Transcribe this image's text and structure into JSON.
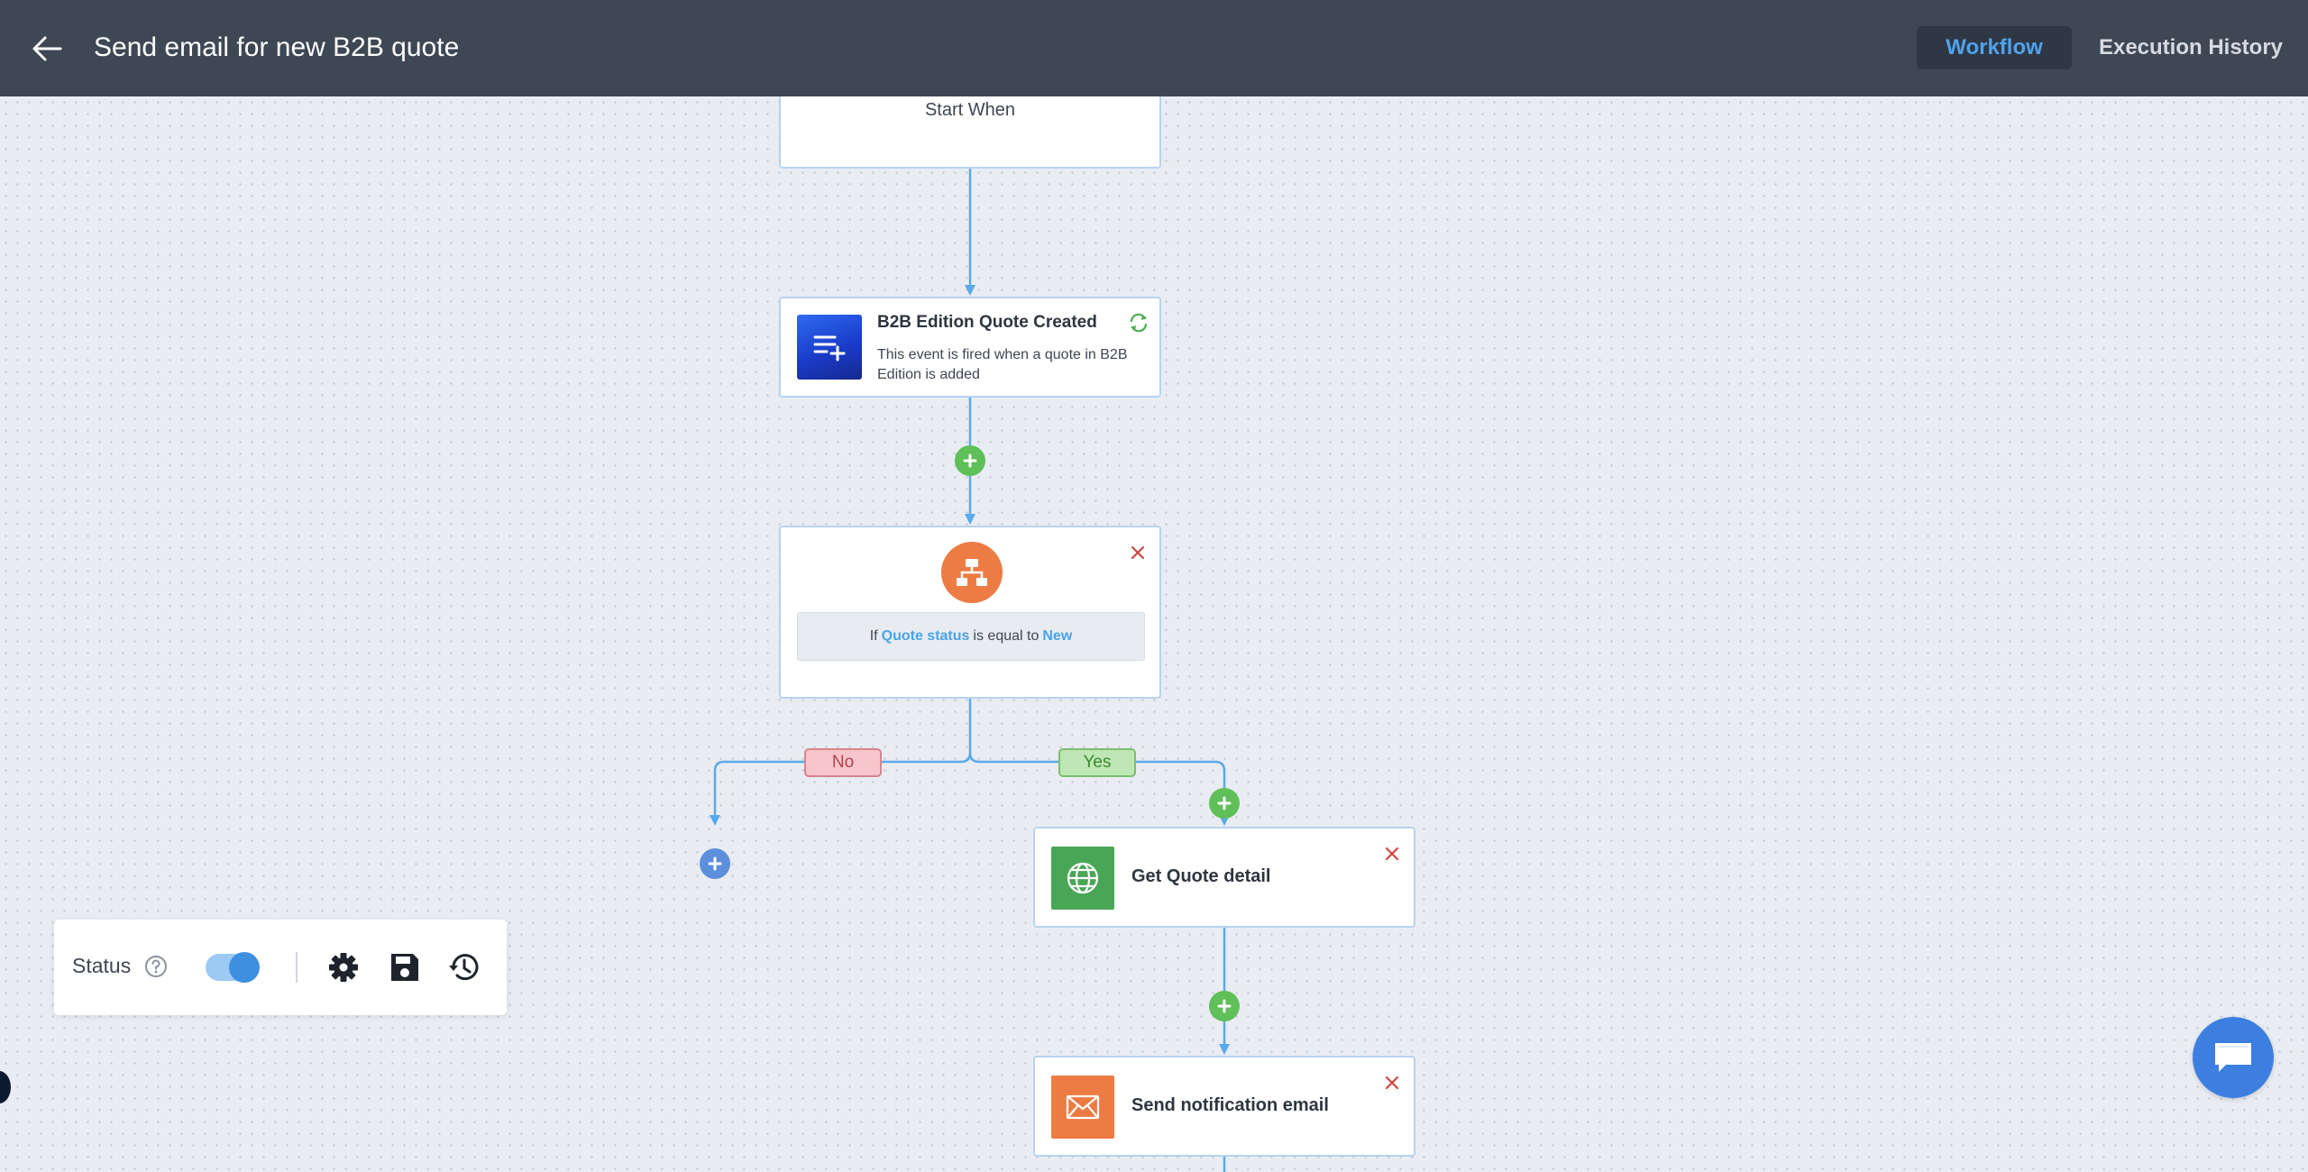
{
  "header": {
    "title": "Send email for new B2B quote",
    "tabs": [
      {
        "label": "Workflow",
        "active": true
      },
      {
        "label": "Execution History",
        "active": false
      }
    ]
  },
  "workflow": {
    "start": {
      "label": "Start When"
    },
    "trigger": {
      "title": "B2B Edition Quote Created",
      "description": "This event is fired when a quote in B2B Edition is added",
      "icon": "list-add-icon"
    },
    "condition": {
      "prefix": "If",
      "field": "Quote status",
      "operator": "is equal to",
      "value": "New",
      "icon": "sitemap-icon"
    },
    "branches": {
      "no_label": "No",
      "yes_label": "Yes"
    },
    "actions": [
      {
        "label": "Get Quote detail",
        "icon": "globe-icon",
        "color": "#4aa657"
      },
      {
        "label": "Send notification email",
        "icon": "envelope-icon",
        "color": "#ec7c44"
      }
    ]
  },
  "statusbar": {
    "status_label": "Status",
    "enabled": true
  },
  "colors": {
    "header_bg": "#3e4754",
    "accent": "#4fa3ee",
    "connector": "#5aa9ea",
    "add_green": "#5fbf58",
    "add_blue": "#5d8fdc"
  }
}
